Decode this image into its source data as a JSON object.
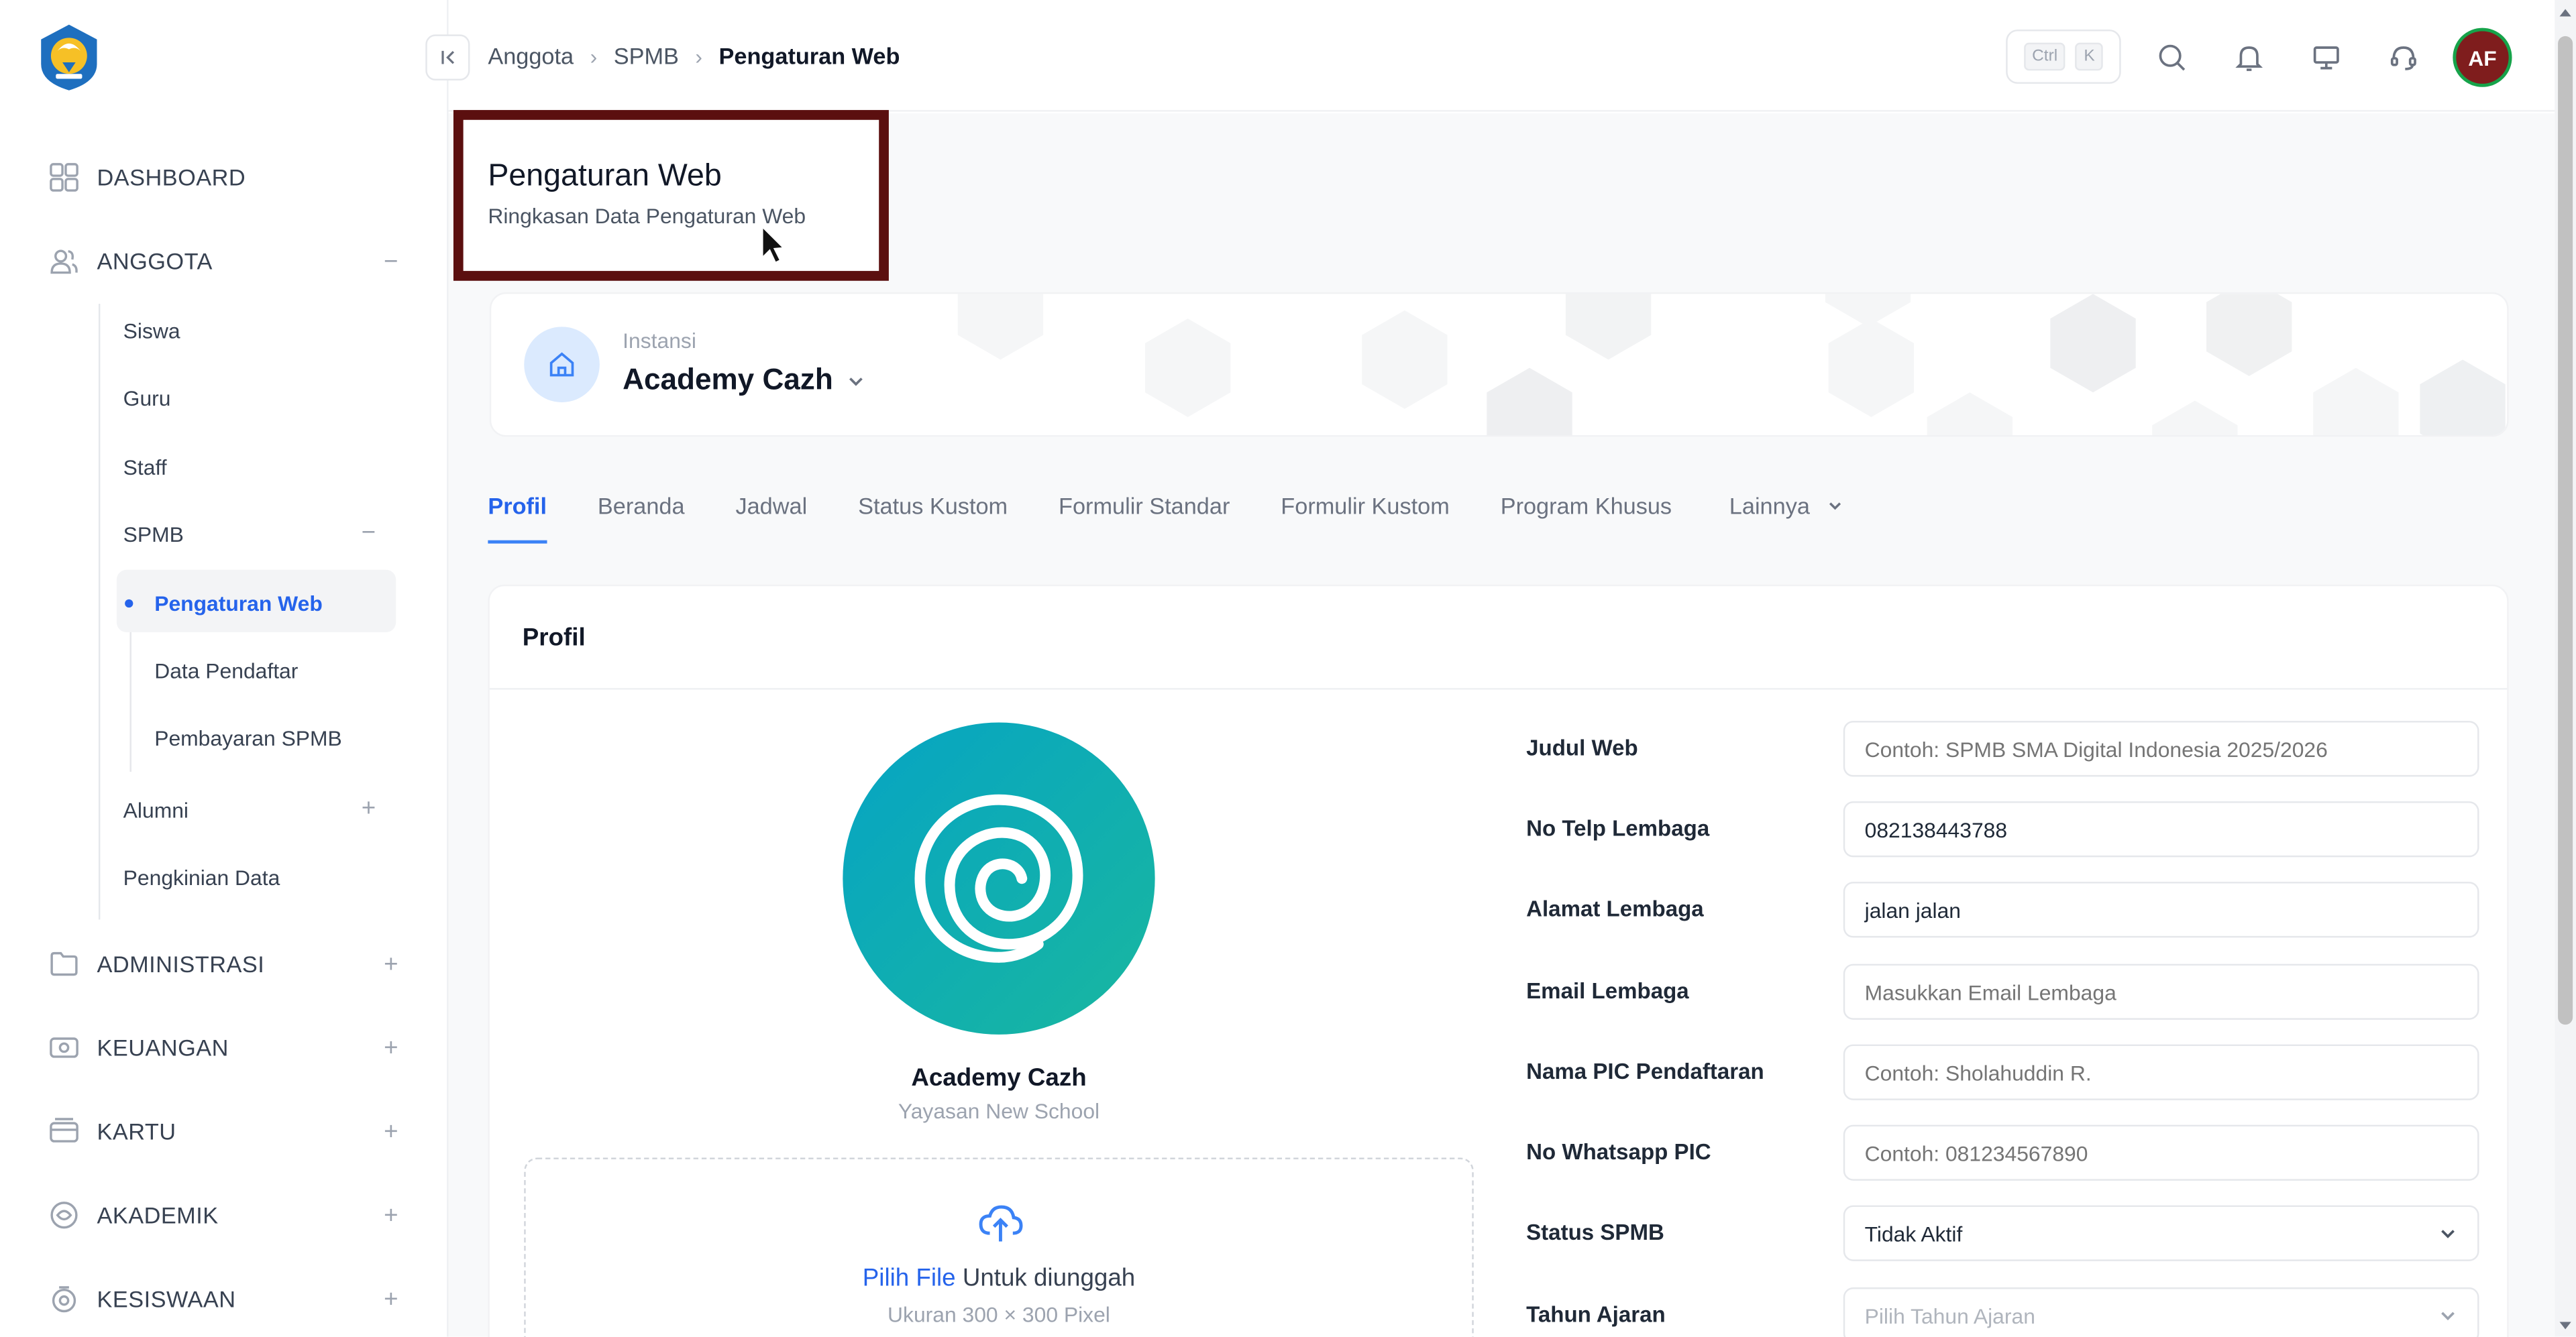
{
  "sidebar": {
    "nav": [
      {
        "label": "DASHBOARD",
        "icon": "grid-icon"
      },
      {
        "label": "ANGGOTA",
        "icon": "users-icon",
        "toggle": "−"
      },
      {
        "label": "ADMINISTRASI",
        "icon": "folder-icon",
        "toggle": "+"
      },
      {
        "label": "KEUANGAN",
        "icon": "money-icon",
        "toggle": "+"
      },
      {
        "label": "KARTU",
        "icon": "card-icon",
        "toggle": "+"
      },
      {
        "label": "AKADEMIK",
        "icon": "academic-icon",
        "toggle": "+"
      },
      {
        "label": "KESISWAAN",
        "icon": "student-icon",
        "toggle": "+"
      }
    ],
    "anggota_items": [
      {
        "label": "Siswa"
      },
      {
        "label": "Guru"
      },
      {
        "label": "Staff"
      },
      {
        "label": "SPMB",
        "toggle": "−"
      },
      {
        "label": "Alumni",
        "toggle": "+"
      },
      {
        "label": "Pengkinian Data"
      }
    ],
    "spmb_items": [
      {
        "label": "Pengaturan Web",
        "active": true
      },
      {
        "label": "Data Pendaftar"
      },
      {
        "label": "Pembayaran SPMB"
      }
    ]
  },
  "topbar": {
    "breadcrumb": [
      "Anggota",
      "SPMB",
      "Pengaturan Web"
    ],
    "kbd": [
      "Ctrl",
      "K"
    ],
    "avatar": "AF"
  },
  "page": {
    "title": "Pengaturan Web",
    "subtitle": "Ringkasan Data Pengaturan Web"
  },
  "instansi": {
    "label": "Instansi",
    "name": "Academy Cazh"
  },
  "tabs": [
    "Profil",
    "Beranda",
    "Jadwal",
    "Status Kustom",
    "Formulir Standar",
    "Formulir Kustom",
    "Program Khusus",
    "Lainnya"
  ],
  "profil": {
    "heading": "Profil",
    "org_name": "Academy Cazh",
    "org_sub": "Yayasan New School",
    "upload_link": "Pilih File",
    "upload_text": " Untuk diunggah",
    "upload_hint": "Ukuran 300 × 300 Pixel",
    "fields": [
      {
        "label": "Judul Web",
        "value": "",
        "placeholder": "Contoh: SPMB SMA Digital Indonesia 2025/2026"
      },
      {
        "label": "No Telp Lembaga",
        "value": "082138443788",
        "placeholder": ""
      },
      {
        "label": "Alamat Lembaga",
        "value": "jalan jalan",
        "placeholder": ""
      },
      {
        "label": "Email Lembaga",
        "value": "",
        "placeholder": "Masukkan Email Lembaga"
      },
      {
        "label": "Nama PIC Pendaftaran",
        "value": "",
        "placeholder": "Contoh: Sholahuddin R."
      },
      {
        "label": "No Whatsapp PIC",
        "value": "",
        "placeholder": "Contoh: 081234567890"
      },
      {
        "label": "Status SPMB",
        "value": "Tidak Aktif",
        "placeholder": "",
        "select": true
      },
      {
        "label": "Tahun Ajaran",
        "value": "",
        "placeholder": "Pilih Tahun Ajaran",
        "select": true
      }
    ]
  },
  "colors": {
    "accent": "#2563eb",
    "highlight_border": "#5b0f0f",
    "logo_gradient_start": "#06a4c4",
    "logo_gradient_end": "#19b79f"
  }
}
